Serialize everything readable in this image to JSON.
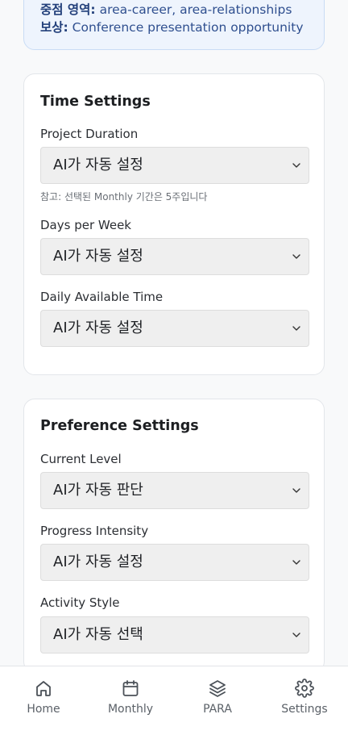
{
  "info": {
    "focus_label": "중점 영역:",
    "focus_value": "area-career, area-relationships",
    "reward_label": "보상:",
    "reward_value": "Conference presentation opportunity"
  },
  "time_settings": {
    "title": "Time Settings",
    "fields": [
      {
        "label": "Project Duration",
        "value": "AI가 자동 설정",
        "note": "참고: 선택된 Monthly 기간은 5주입니다"
      },
      {
        "label": "Days per Week",
        "value": "AI가 자동 설정"
      },
      {
        "label": "Daily Available Time",
        "value": "AI가 자동 설정"
      }
    ]
  },
  "preference_settings": {
    "title": "Preference Settings",
    "fields": [
      {
        "label": "Current Level",
        "value": "AI가 자동 판단"
      },
      {
        "label": "Progress Intensity",
        "value": "AI가 자동 설정"
      },
      {
        "label": "Activity Style",
        "value": "AI가 자동 선택"
      }
    ]
  },
  "nav": {
    "items": [
      {
        "label": "Home",
        "icon": "home-icon"
      },
      {
        "label": "Monthly",
        "icon": "calendar-icon"
      },
      {
        "label": "PARA",
        "icon": "layers-icon"
      },
      {
        "label": "Settings",
        "icon": "gear-icon"
      }
    ]
  }
}
